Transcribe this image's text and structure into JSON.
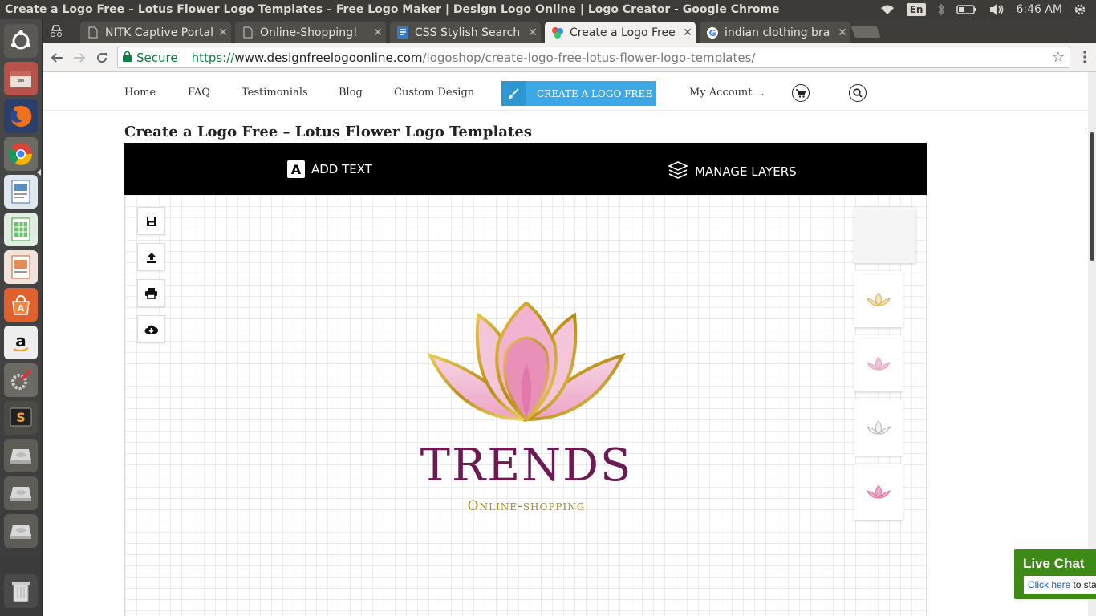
{
  "os": {
    "window_title": "Create a Logo Free – Lotus Flower Logo Templates – Free Logo Maker | Design Logo Online | Logo Creator - Google Chrome",
    "lang": "En",
    "time": "6:46 AM",
    "launcher_items": [
      "dash-icon",
      "files-icon",
      "firefox-icon",
      "chrome-icon",
      "writer-icon",
      "calc-icon",
      "impress-icon",
      "software-center-icon",
      "amazon-icon",
      "system-settings-icon",
      "sublime-text-icon",
      "drive-icon",
      "drive-icon",
      "drive-icon",
      "trash-icon"
    ]
  },
  "browser": {
    "tabs": [
      {
        "label": "NITK Captive Portal",
        "active": false
      },
      {
        "label": "Online-Shopping!",
        "active": false
      },
      {
        "label": "CSS Stylish Search E",
        "active": false
      },
      {
        "label": "Create a Logo Free",
        "active": true
      },
      {
        "label": "indian clothing bra",
        "active": false
      }
    ],
    "secure_label": "Secure",
    "url_scheme": "https://",
    "url_host": "www.designfreelogoonline.com",
    "url_path": "/logoshop/create-logo-free-lotus-flower-logo-templates/"
  },
  "site": {
    "nav": {
      "home": "Home",
      "faq": "FAQ",
      "testimonials": "Testimonials",
      "blog": "Blog",
      "custom_design": "Custom Design",
      "cta": "CREATE A LOGO FREE",
      "account": "My Account"
    },
    "page_title": "Create a Logo Free – Lotus Flower Logo Templates",
    "toolbar": {
      "add_text": "ADD TEXT",
      "add_text_glyph": "A",
      "manage_layers": "MANAGE LAYERS"
    },
    "tools": [
      "save-icon",
      "upload-icon",
      "print-icon",
      "cloud-download-icon"
    ],
    "logo": {
      "name": "TRENDS",
      "tagline": "Online-shopping",
      "colors": {
        "name": "#6b1a54",
        "tagline": "#a88d1a",
        "petals": "#f2b8d2",
        "outline": "#c9a21e"
      }
    },
    "thumbnail_colors": [
      "#f5f5f5",
      "#e8cf8a",
      "#e7a3c4",
      "#cfcfcf",
      "#e78fb8"
    ]
  },
  "livechat": {
    "title": "Live Chat",
    "link": "Click here",
    "rest": "to start"
  }
}
